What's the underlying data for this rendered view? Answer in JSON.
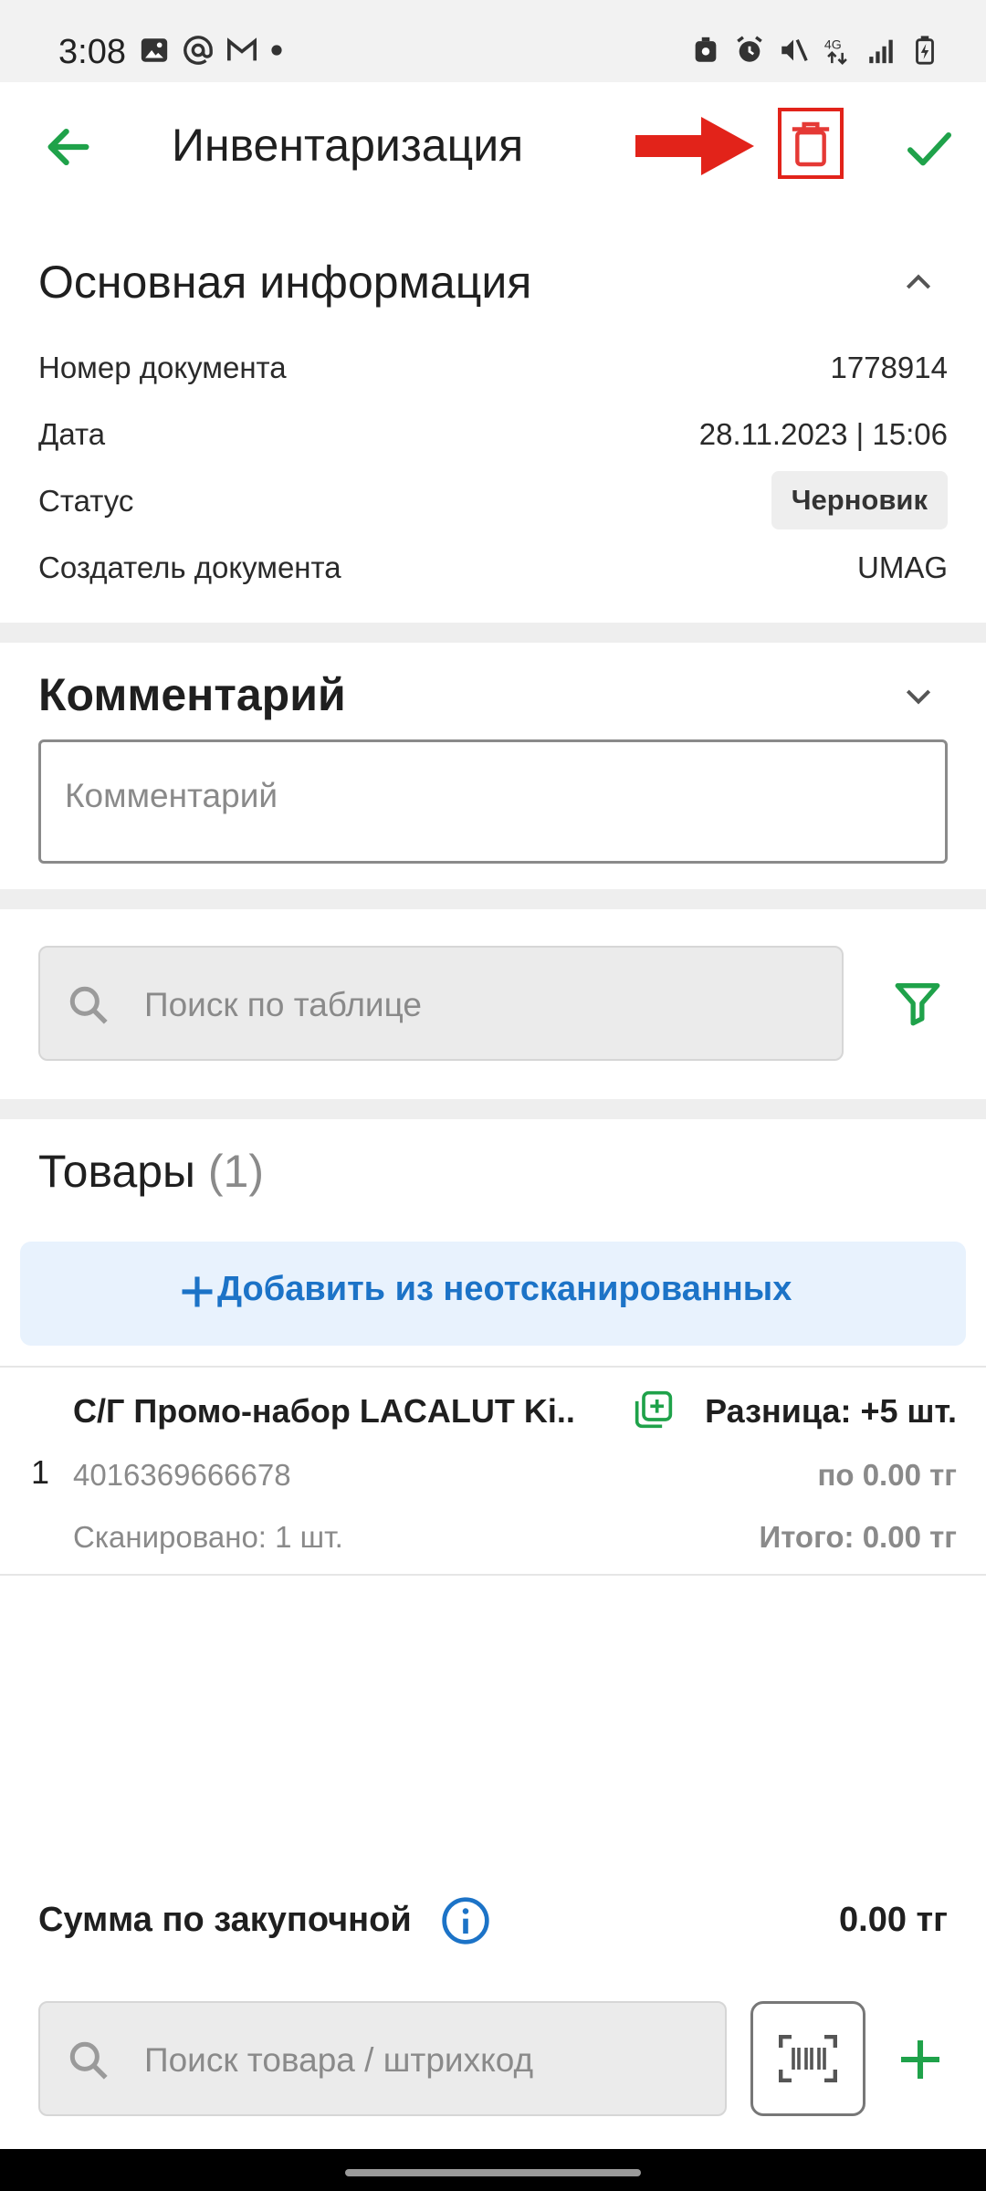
{
  "statusbar": {
    "time": "3:08"
  },
  "header": {
    "title": "Инвентаризация"
  },
  "main_info": {
    "title": "Основная информация",
    "rows": [
      {
        "label": "Номер документа",
        "value": "1778914"
      },
      {
        "label": "Дата",
        "value": "28.11.2023 | 15:06"
      },
      {
        "label": "Статус",
        "value": "Черновик"
      },
      {
        "label": "Создатель документа",
        "value": "UMAG"
      }
    ]
  },
  "comment": {
    "title": "Комментарий",
    "placeholder": "Комментарий"
  },
  "table_search": {
    "placeholder": "Поиск по таблице"
  },
  "goods": {
    "title": "Товары",
    "count": "(1)",
    "add_label": "Добавить из неотсканированных",
    "items": [
      {
        "index": "1",
        "name": "С/Г Промо-набор LACALUT Ki..",
        "barcode": "4016369666678",
        "scanned": "Сканировано: 1 шт.",
        "difference": "Разница: +5 шт.",
        "price": "по 0.00 тг",
        "total": "Итого: 0.00 тг"
      }
    ]
  },
  "footer": {
    "sum_label": "Сумма по закупочной",
    "sum_value": "0.00 тг",
    "search_placeholder": "Поиск товара / штрихкод"
  },
  "colors": {
    "accent_green": "#1fa24a",
    "accent_blue": "#1c73c7",
    "highlight_red": "#e2231a"
  }
}
